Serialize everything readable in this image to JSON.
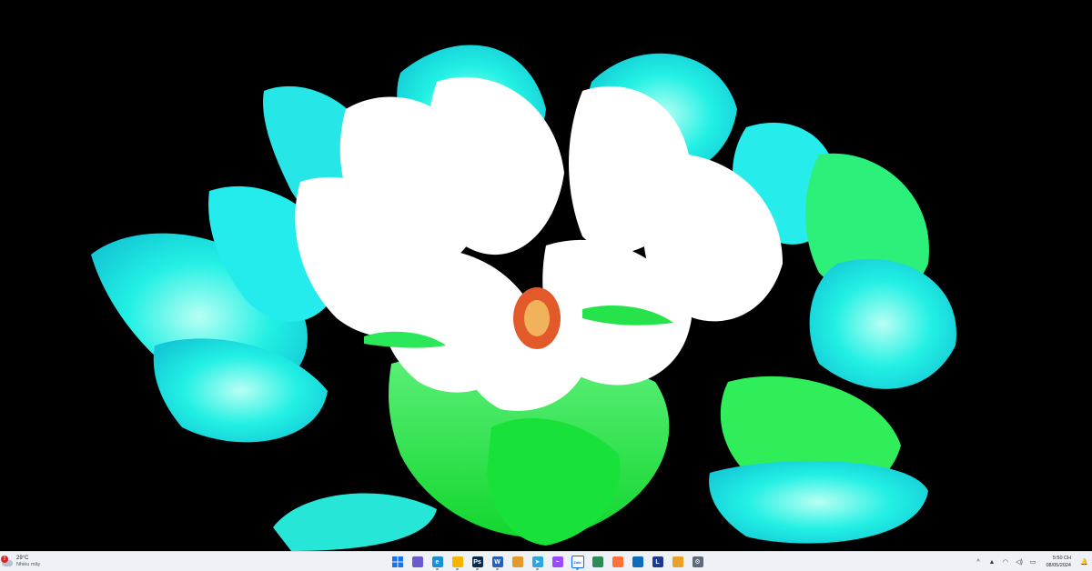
{
  "weather": {
    "alert_badge": "!",
    "temperature": "29°C",
    "description": "Nhiều mây"
  },
  "taskbar_apps": [
    {
      "name": "windows-start",
      "glyph": "",
      "color": "#1a73e8"
    },
    {
      "name": "copilot",
      "glyph": "",
      "color": "#6a5acd"
    },
    {
      "name": "edge",
      "glyph": "e",
      "color": "#1b8fd6"
    },
    {
      "name": "file-explorer",
      "glyph": "",
      "color": "#f4b400"
    },
    {
      "name": "photoshop",
      "glyph": "Ps",
      "color": "#0b2a4a"
    },
    {
      "name": "word",
      "glyph": "W",
      "color": "#2b5fb4"
    },
    {
      "name": "app-orange",
      "glyph": "",
      "color": "#e39a2b"
    },
    {
      "name": "telegram",
      "glyph": "➤",
      "color": "#2ca5e0"
    },
    {
      "name": "messenger",
      "glyph": "~",
      "color": "#9b4bff"
    },
    {
      "name": "zalo",
      "glyph": "Zalo",
      "color": "#ffffff"
    },
    {
      "name": "app-green",
      "glyph": "",
      "color": "#2e8b57"
    },
    {
      "name": "firefox",
      "glyph": "",
      "color": "#ff7139"
    },
    {
      "name": "outlook",
      "glyph": "",
      "color": "#0f6cbd"
    },
    {
      "name": "app-l",
      "glyph": "L",
      "color": "#1f3a8a"
    },
    {
      "name": "photos",
      "glyph": "",
      "color": "#e9a227"
    },
    {
      "name": "settings",
      "glyph": "⚙",
      "color": "#5f6b7a"
    }
  ],
  "tray": {
    "chevron": "^",
    "clock_time": "5:50 CH",
    "clock_date": "08/05/2024"
  },
  "colors": {
    "flower_white": "#ffffff",
    "flower_cyan": "#1ff0e6",
    "flower_green": "#1ee84a",
    "stamen": "#e35a2a",
    "taskbar": "#eef1f6"
  }
}
